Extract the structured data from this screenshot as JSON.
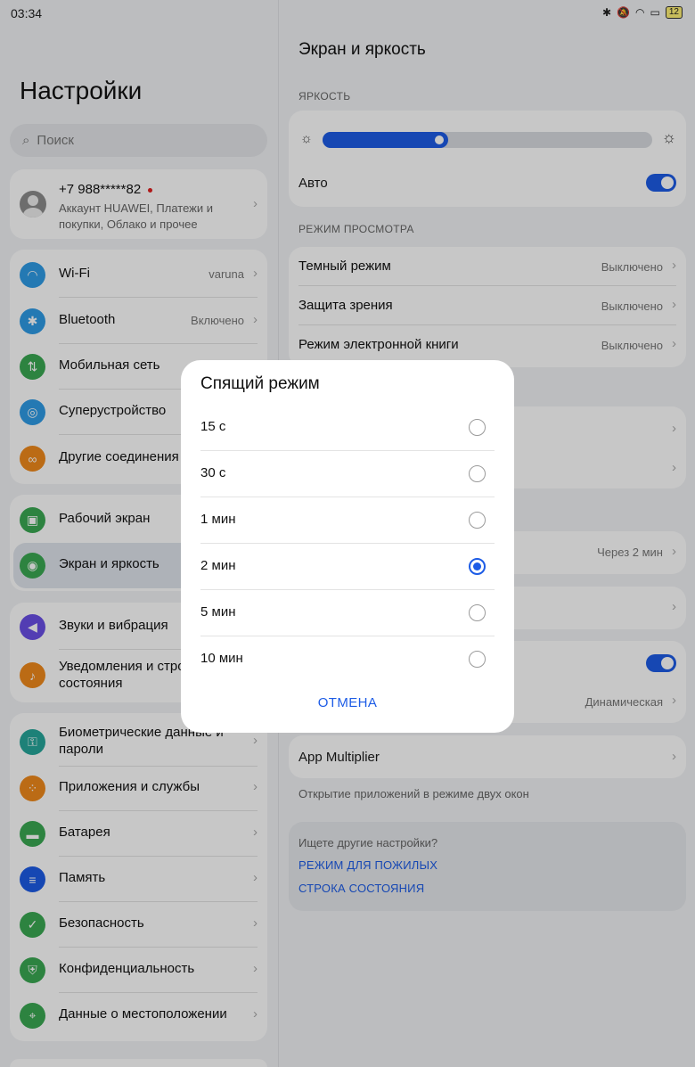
{
  "status_bar": {
    "time": "03:34",
    "battery": "12"
  },
  "left": {
    "title": "Настройки",
    "search_placeholder": "Поиск",
    "account": {
      "phone": "+7 988*****82",
      "subtitle": "Аккаунт HUAWEI, Платежи и покупки, Облако и прочее"
    },
    "group1": [
      {
        "label": "Wi-Fi",
        "value": "varuna",
        "icon": "wifi-icon",
        "color": "#2f9be6"
      },
      {
        "label": "Bluetooth",
        "value": "Включено",
        "icon": "bluetooth-icon",
        "color": "#2f9be6"
      },
      {
        "label": "Мобильная сеть",
        "value": "",
        "icon": "mobile-data-icon",
        "color": "#3aa853"
      },
      {
        "label": "Суперустройство",
        "value": "",
        "icon": "superdevice-icon",
        "color": "#2f9be6"
      },
      {
        "label": "Другие соединения",
        "value": "",
        "icon": "link-icon",
        "color": "#f08a1c"
      }
    ],
    "group2": [
      {
        "label": "Рабочий экран",
        "icon": "home-screen-icon",
        "color": "#3aa853"
      },
      {
        "label": "Экран и яркость",
        "icon": "eye-icon",
        "color": "#3aa853"
      }
    ],
    "group3": [
      {
        "label": "Звуки и вибрация",
        "icon": "sound-icon",
        "color": "#6a4fe6"
      },
      {
        "label": "Уведомления и строка состояния",
        "icon": "bell-icon",
        "color": "#f08a1c"
      }
    ],
    "group4": [
      {
        "label": "Биометрические данные и пароли",
        "icon": "key-icon",
        "color": "#26a69a"
      },
      {
        "label": "Приложения и службы",
        "icon": "apps-icon",
        "color": "#f08a1c"
      },
      {
        "label": "Батарея",
        "icon": "battery-icon",
        "color": "#3aa853"
      },
      {
        "label": "Память",
        "icon": "storage-icon",
        "color": "#1d5ce6"
      },
      {
        "label": "Безопасность",
        "icon": "shield-icon",
        "color": "#3aa853"
      },
      {
        "label": "Конфиденциальность",
        "icon": "privacy-icon",
        "color": "#3aa853"
      },
      {
        "label": "Данные о местоположении",
        "icon": "location-icon",
        "color": "#3aa853"
      }
    ]
  },
  "right": {
    "title": "Экран и яркость",
    "brightness_section": "ЯРКОСТЬ",
    "brightness_level": 0.38,
    "auto_label": "Авто",
    "view_section": "РЕЖИМ ПРОСМОТРА",
    "view_rows": [
      {
        "label": "Темный режим",
        "value": "Выключено"
      },
      {
        "label": "Защита зрения",
        "value": "Выключено"
      },
      {
        "label": "Режим электронной книги",
        "value": "Выключено"
      }
    ],
    "sleep_value": "Через 2 мин",
    "refresh_value": "Динамическая",
    "app_multiplier": "App Multiplier",
    "app_multiplier_note": "Открытие приложений в режиме двух окон",
    "other_question": "Ищете другие настройки?",
    "other_links": [
      "РЕЖИМ ДЛЯ ПОЖИЛЫХ",
      "СТРОКА СОСТОЯНИЯ"
    ]
  },
  "dialog": {
    "title": "Спящий режим",
    "options": [
      "15 с",
      "30 с",
      "1 мин",
      "2 мин",
      "5 мин",
      "10 мин"
    ],
    "selected": "2 мин",
    "cancel": "ОТМЕНА"
  },
  "colors": {
    "accent": "#1d5ce6"
  }
}
